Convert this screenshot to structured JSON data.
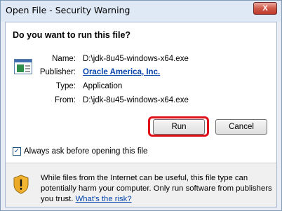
{
  "window": {
    "title": "Open File - Security Warning",
    "close_symbol": "X"
  },
  "dialog": {
    "heading": "Do you want to run this file?",
    "fields": [
      {
        "label": "Name:",
        "value": "D:\\jdk-8u45-windows-x64.exe"
      },
      {
        "label": "Publisher:",
        "value": "Oracle America, Inc."
      },
      {
        "label": "Type:",
        "value": "Application"
      },
      {
        "label": "From:",
        "value": "D:\\jdk-8u45-windows-x64.exe"
      }
    ],
    "buttons": {
      "run": "Run",
      "cancel": "Cancel"
    },
    "checkbox": {
      "label": "Always ask before opening this file",
      "checked": true,
      "check_glyph": "✓"
    },
    "warning": {
      "text": "While files from the Internet can be useful, this file type can potentially harm your computer. Only run software from publishers you trust.",
      "link": "What's the risk?"
    }
  },
  "colors": {
    "highlight": "#e0101a",
    "link": "#0645ad",
    "close_red": "#c0392b"
  }
}
